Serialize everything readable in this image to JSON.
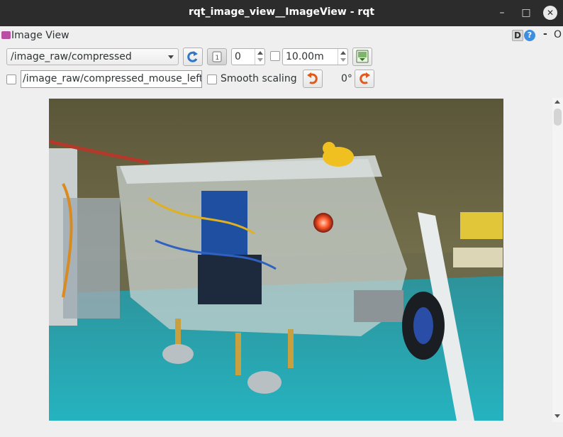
{
  "window": {
    "title": "rqt_image_view__ImageView - rqt",
    "minimize_glyph": "–",
    "maximize_glyph": "□",
    "close_glyph": "✕"
  },
  "plugin": {
    "title": "Image View",
    "d_label": "D",
    "help_label": "?",
    "minimize_label": "-",
    "float_label": "O"
  },
  "toolbar": {
    "topic": "/image_raw/compressed",
    "spin_value": "0",
    "max_range": "10.00m",
    "mouse_topic": "/image_raw/compressed_mouse_left",
    "smooth_scaling_label": "Smooth scaling",
    "rotation": "0°"
  },
  "colors": {
    "titlebar": "#2c2c2c",
    "accent": "#3d8ee0",
    "rotate_icon": "#e05a1a"
  },
  "image": {
    "description_icon": "camera-frame"
  }
}
